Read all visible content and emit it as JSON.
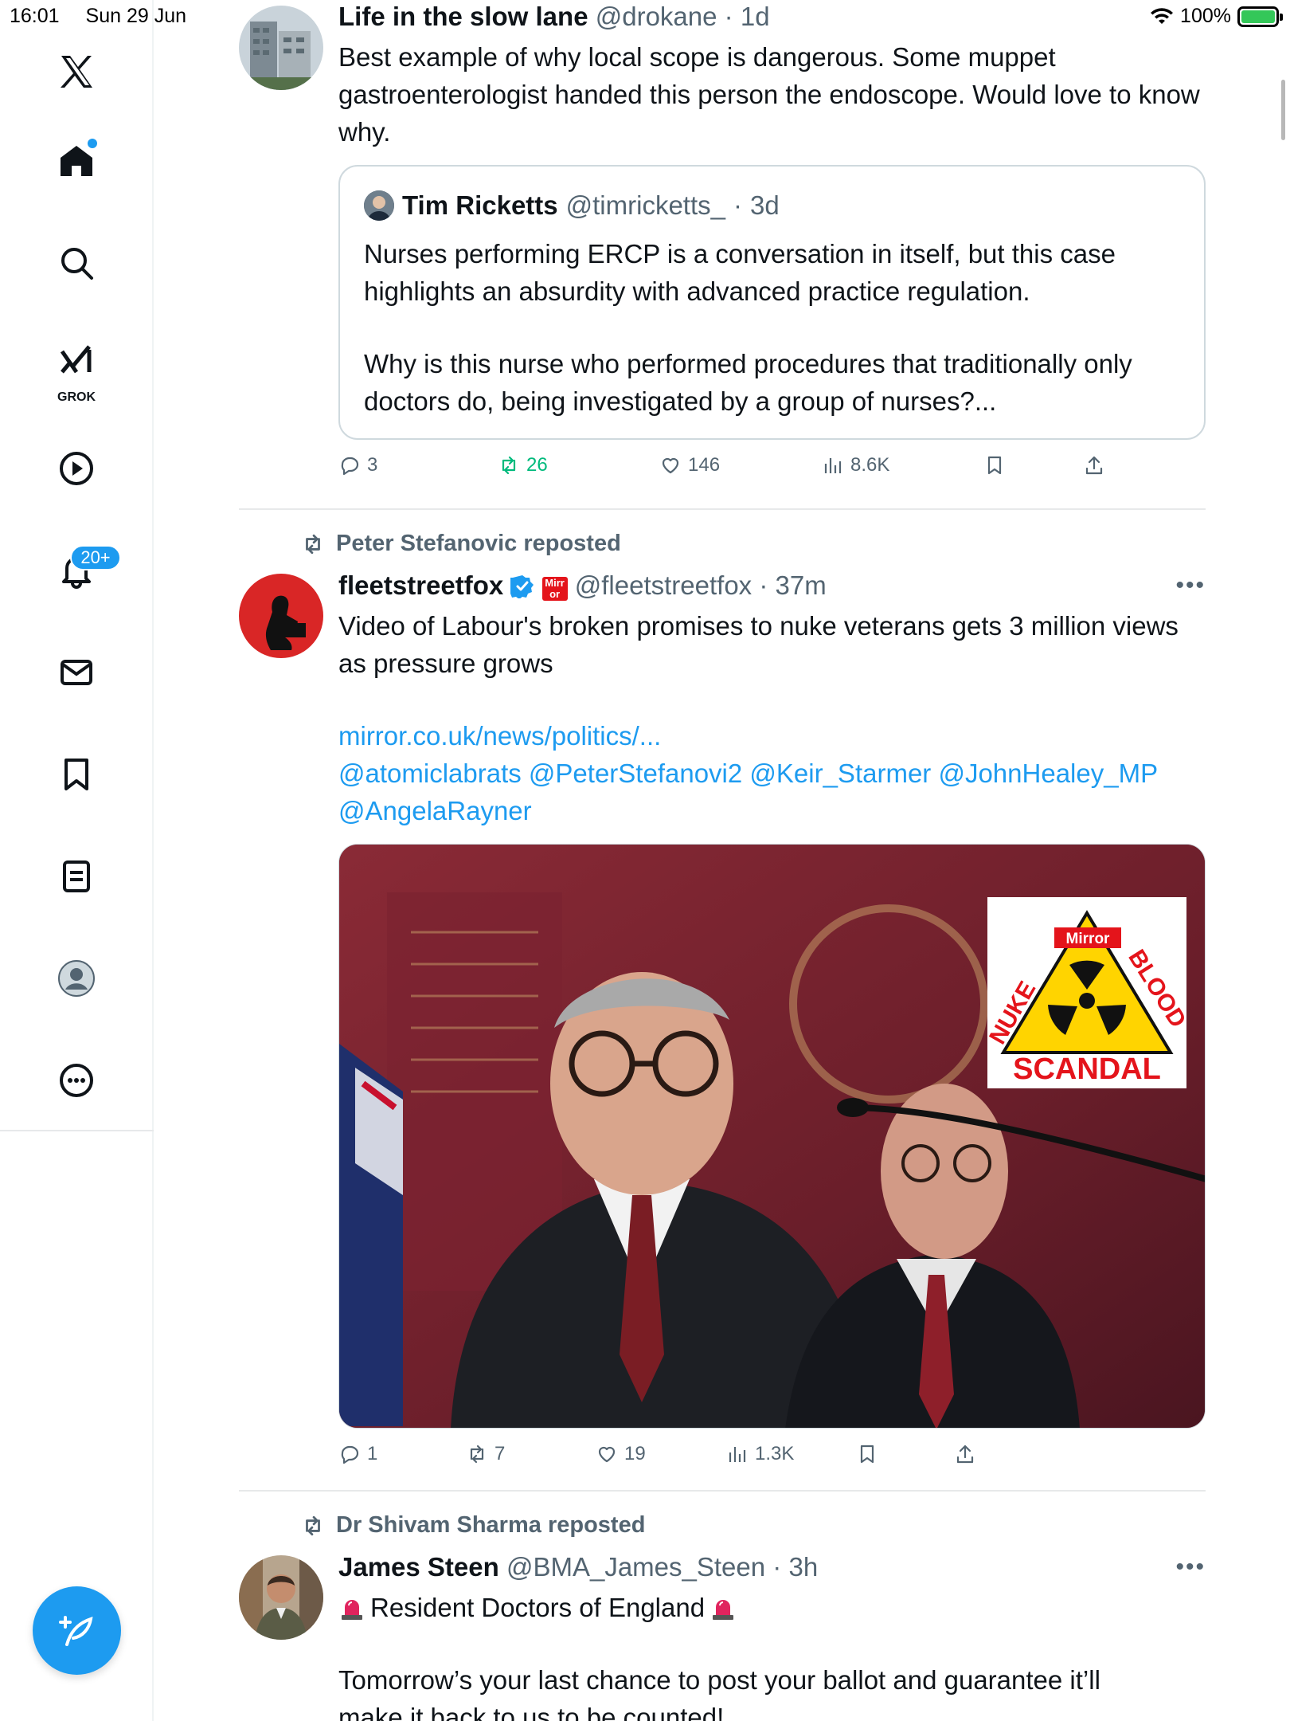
{
  "status_bar": {
    "time": "16:01",
    "date": "Sun 29 Jun",
    "battery": "100%"
  },
  "sidebar": {
    "items": [
      {
        "label": "",
        "icon": "x-logo-icon"
      },
      {
        "label": "",
        "icon": "home-icon"
      },
      {
        "label": "",
        "icon": "search-icon"
      },
      {
        "label": "GROK",
        "icon": "grok-icon"
      },
      {
        "label": "",
        "icon": "video-play-icon"
      },
      {
        "label": "",
        "icon": "notifications-bell-icon"
      },
      {
        "label": "",
        "icon": "messages-envelope-icon"
      },
      {
        "label": "",
        "icon": "bookmarks-icon"
      },
      {
        "label": "",
        "icon": "lists-icon"
      },
      {
        "label": "",
        "icon": "profile-avatar-icon"
      },
      {
        "label": "",
        "icon": "more-circle-icon"
      }
    ],
    "notifications_badge": "20+",
    "compose_icon": "compose-feather-icon"
  },
  "tweets": [
    {
      "name": "Life in the slow lane",
      "handle": "@drokane",
      "time": "1d",
      "text": "Best example of why local scope is dangerous. Some muppet gastroenterologist handed this person the endoscope. Would love to know why.",
      "quote": {
        "name": "Tim Ricketts",
        "handle": "@timricketts_",
        "time": "3d",
        "text_1": "Nurses performing ERCP is a conversation in itself, but this case highlights an absurdity with advanced practice regulation.",
        "text_2": "Why is this nurse who performed procedures that traditionally only doctors do, being investigated by a group of nurses?..."
      },
      "replies": "3",
      "reposts": "26",
      "likes": "146",
      "views": "8.6K"
    },
    {
      "reposted_by": "Peter Stefanovic reposted",
      "name": "fleetstreetfox",
      "handle": "@fleetstreetfox",
      "time": "37m",
      "text": "Video of Labour's broken promises to nuke veterans gets 3 million views as pressure grows",
      "link": "mirror.co.uk/news/politics/...",
      "mentions_1": "@atomiclabrats @PeterStefanovi2 @Keir_Starmer @JohnHealey_MP",
      "mentions_2": "@AngelaRayner",
      "media_badge": {
        "brand": "Mirror",
        "word_1": "NUKE",
        "word_2": "BLOOD",
        "word_3": "SCANDAL"
      },
      "replies": "1",
      "reposts": "7",
      "likes": "19",
      "views": "1.3K"
    },
    {
      "reposted_by": "Dr Shivam Sharma reposted",
      "name": "James Steen",
      "handle": "@BMA_James_Steen",
      "time": "3h",
      "line_1": "Resident Doctors of England",
      "line_2": "Tomorrow’s your last chance to post your ballot and guarantee it’ll",
      "line_3": "make it back to us to be counted!"
    }
  ],
  "colors": {
    "accent": "#1d9bf0",
    "repost_green": "#00ba7c",
    "muted": "#536471",
    "text": "#0f1419",
    "siren_red": "#e0245e"
  }
}
